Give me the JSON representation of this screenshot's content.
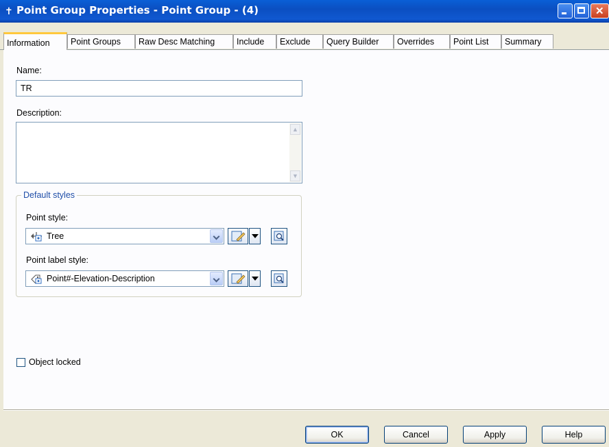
{
  "window": {
    "title": "Point Group Properties - Point Group - (4)",
    "controls": {
      "minimize": "minimize-icon",
      "maximize": "maximize-icon",
      "close": "close-icon"
    }
  },
  "tabs": [
    {
      "label": "Information",
      "active": true
    },
    {
      "label": "Point Groups"
    },
    {
      "label": "Raw Desc Matching"
    },
    {
      "label": "Include"
    },
    {
      "label": "Exclude"
    },
    {
      "label": "Query Builder"
    },
    {
      "label": "Overrides"
    },
    {
      "label": "Point List"
    },
    {
      "label": "Summary"
    }
  ],
  "form": {
    "name_label": "Name:",
    "name_value": "TR",
    "description_label": "Description:",
    "description_value": "",
    "default_styles": {
      "title": "Default styles",
      "point_style_label": "Point style:",
      "point_style_value": "Tree",
      "point_label_style_label": "Point label style:",
      "point_label_style_value": "Point#-Elevation-Description"
    },
    "object_locked_label": "Object locked",
    "object_locked_checked": false
  },
  "buttons": {
    "ok": "OK",
    "cancel": "Cancel",
    "apply": "Apply",
    "help": "Help"
  },
  "colors": {
    "titlebar": "#0b4fc1",
    "active_tab_accent": "#ffc83c",
    "group_title": "#1f4ea8"
  }
}
